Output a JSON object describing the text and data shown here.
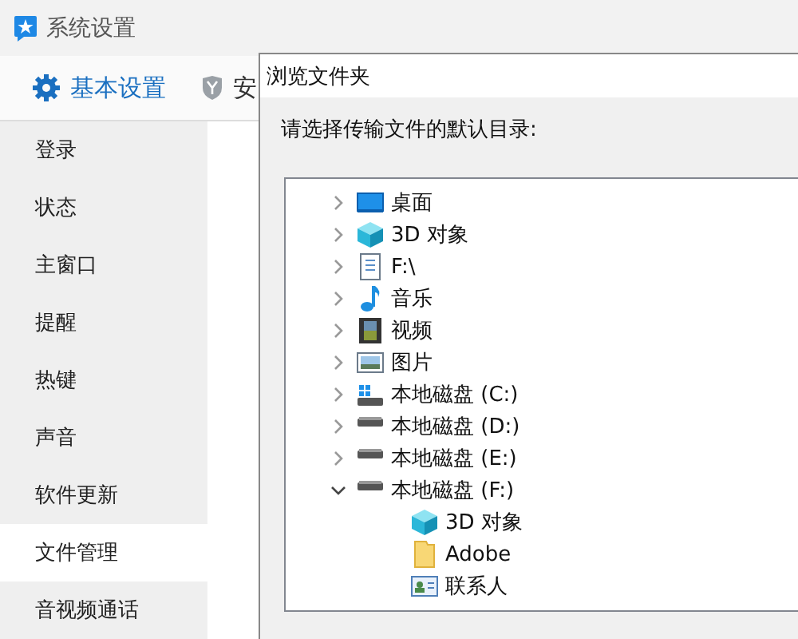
{
  "window": {
    "title": "系统设置"
  },
  "tabs": [
    {
      "label": "基本设置",
      "kind": "gear",
      "selected": true
    },
    {
      "label": "安",
      "kind": "shield",
      "selected": false
    }
  ],
  "sidebar": {
    "items": [
      {
        "label": "登录",
        "selected": false
      },
      {
        "label": "状态",
        "selected": false
      },
      {
        "label": "主窗口",
        "selected": false
      },
      {
        "label": "提醒",
        "selected": false
      },
      {
        "label": "热键",
        "selected": false
      },
      {
        "label": "声音",
        "selected": false
      },
      {
        "label": "软件更新",
        "selected": false
      },
      {
        "label": "文件管理",
        "selected": true
      },
      {
        "label": "音视频通话",
        "selected": false
      }
    ]
  },
  "dialog": {
    "title": "浏览文件夹",
    "prompt": "请选择传输文件的默认目录:",
    "tree": [
      {
        "label": "桌面",
        "kind": "desktop",
        "expanded": false
      },
      {
        "label": "3D 对象",
        "kind": "cube",
        "expanded": false
      },
      {
        "label": "F:\\",
        "kind": "document",
        "expanded": false
      },
      {
        "label": "音乐",
        "kind": "music",
        "expanded": false
      },
      {
        "label": "视频",
        "kind": "film",
        "expanded": false
      },
      {
        "label": "图片",
        "kind": "image",
        "expanded": false
      },
      {
        "label": "本地磁盘 (C:)",
        "kind": "system-drive",
        "expanded": false
      },
      {
        "label": "本地磁盘 (D:)",
        "kind": "drive",
        "expanded": false
      },
      {
        "label": "本地磁盘 (E:)",
        "kind": "drive",
        "expanded": false
      },
      {
        "label": "本地磁盘 (F:)",
        "kind": "drive",
        "expanded": true,
        "children": [
          {
            "label": "3D 对象",
            "kind": "cube"
          },
          {
            "label": "Adobe",
            "kind": "folder"
          },
          {
            "label": "联系人",
            "kind": "contact"
          }
        ]
      }
    ]
  }
}
